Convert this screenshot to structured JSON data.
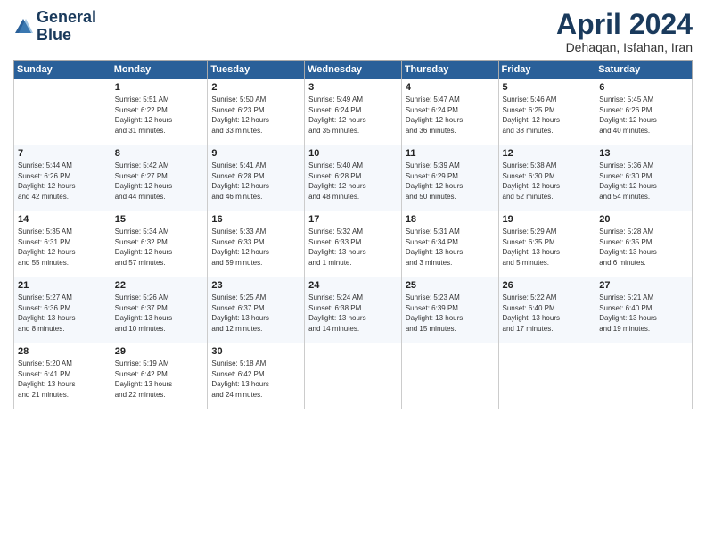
{
  "logo": {
    "line1": "General",
    "line2": "Blue"
  },
  "title": "April 2024",
  "subtitle": "Dehaqan, Isfahan, Iran",
  "days_of_week": [
    "Sunday",
    "Monday",
    "Tuesday",
    "Wednesday",
    "Thursday",
    "Friday",
    "Saturday"
  ],
  "weeks": [
    [
      {
        "day": "",
        "info": ""
      },
      {
        "day": "1",
        "info": "Sunrise: 5:51 AM\nSunset: 6:22 PM\nDaylight: 12 hours\nand 31 minutes."
      },
      {
        "day": "2",
        "info": "Sunrise: 5:50 AM\nSunset: 6:23 PM\nDaylight: 12 hours\nand 33 minutes."
      },
      {
        "day": "3",
        "info": "Sunrise: 5:49 AM\nSunset: 6:24 PM\nDaylight: 12 hours\nand 35 minutes."
      },
      {
        "day": "4",
        "info": "Sunrise: 5:47 AM\nSunset: 6:24 PM\nDaylight: 12 hours\nand 36 minutes."
      },
      {
        "day": "5",
        "info": "Sunrise: 5:46 AM\nSunset: 6:25 PM\nDaylight: 12 hours\nand 38 minutes."
      },
      {
        "day": "6",
        "info": "Sunrise: 5:45 AM\nSunset: 6:26 PM\nDaylight: 12 hours\nand 40 minutes."
      }
    ],
    [
      {
        "day": "7",
        "info": "Sunrise: 5:44 AM\nSunset: 6:26 PM\nDaylight: 12 hours\nand 42 minutes."
      },
      {
        "day": "8",
        "info": "Sunrise: 5:42 AM\nSunset: 6:27 PM\nDaylight: 12 hours\nand 44 minutes."
      },
      {
        "day": "9",
        "info": "Sunrise: 5:41 AM\nSunset: 6:28 PM\nDaylight: 12 hours\nand 46 minutes."
      },
      {
        "day": "10",
        "info": "Sunrise: 5:40 AM\nSunset: 6:28 PM\nDaylight: 12 hours\nand 48 minutes."
      },
      {
        "day": "11",
        "info": "Sunrise: 5:39 AM\nSunset: 6:29 PM\nDaylight: 12 hours\nand 50 minutes."
      },
      {
        "day": "12",
        "info": "Sunrise: 5:38 AM\nSunset: 6:30 PM\nDaylight: 12 hours\nand 52 minutes."
      },
      {
        "day": "13",
        "info": "Sunrise: 5:36 AM\nSunset: 6:30 PM\nDaylight: 12 hours\nand 54 minutes."
      }
    ],
    [
      {
        "day": "14",
        "info": "Sunrise: 5:35 AM\nSunset: 6:31 PM\nDaylight: 12 hours\nand 55 minutes."
      },
      {
        "day": "15",
        "info": "Sunrise: 5:34 AM\nSunset: 6:32 PM\nDaylight: 12 hours\nand 57 minutes."
      },
      {
        "day": "16",
        "info": "Sunrise: 5:33 AM\nSunset: 6:33 PM\nDaylight: 12 hours\nand 59 minutes."
      },
      {
        "day": "17",
        "info": "Sunrise: 5:32 AM\nSunset: 6:33 PM\nDaylight: 13 hours\nand 1 minute."
      },
      {
        "day": "18",
        "info": "Sunrise: 5:31 AM\nSunset: 6:34 PM\nDaylight: 13 hours\nand 3 minutes."
      },
      {
        "day": "19",
        "info": "Sunrise: 5:29 AM\nSunset: 6:35 PM\nDaylight: 13 hours\nand 5 minutes."
      },
      {
        "day": "20",
        "info": "Sunrise: 5:28 AM\nSunset: 6:35 PM\nDaylight: 13 hours\nand 6 minutes."
      }
    ],
    [
      {
        "day": "21",
        "info": "Sunrise: 5:27 AM\nSunset: 6:36 PM\nDaylight: 13 hours\nand 8 minutes."
      },
      {
        "day": "22",
        "info": "Sunrise: 5:26 AM\nSunset: 6:37 PM\nDaylight: 13 hours\nand 10 minutes."
      },
      {
        "day": "23",
        "info": "Sunrise: 5:25 AM\nSunset: 6:37 PM\nDaylight: 13 hours\nand 12 minutes."
      },
      {
        "day": "24",
        "info": "Sunrise: 5:24 AM\nSunset: 6:38 PM\nDaylight: 13 hours\nand 14 minutes."
      },
      {
        "day": "25",
        "info": "Sunrise: 5:23 AM\nSunset: 6:39 PM\nDaylight: 13 hours\nand 15 minutes."
      },
      {
        "day": "26",
        "info": "Sunrise: 5:22 AM\nSunset: 6:40 PM\nDaylight: 13 hours\nand 17 minutes."
      },
      {
        "day": "27",
        "info": "Sunrise: 5:21 AM\nSunset: 6:40 PM\nDaylight: 13 hours\nand 19 minutes."
      }
    ],
    [
      {
        "day": "28",
        "info": "Sunrise: 5:20 AM\nSunset: 6:41 PM\nDaylight: 13 hours\nand 21 minutes."
      },
      {
        "day": "29",
        "info": "Sunrise: 5:19 AM\nSunset: 6:42 PM\nDaylight: 13 hours\nand 22 minutes."
      },
      {
        "day": "30",
        "info": "Sunrise: 5:18 AM\nSunset: 6:42 PM\nDaylight: 13 hours\nand 24 minutes."
      },
      {
        "day": "",
        "info": ""
      },
      {
        "day": "",
        "info": ""
      },
      {
        "day": "",
        "info": ""
      },
      {
        "day": "",
        "info": ""
      }
    ]
  ]
}
